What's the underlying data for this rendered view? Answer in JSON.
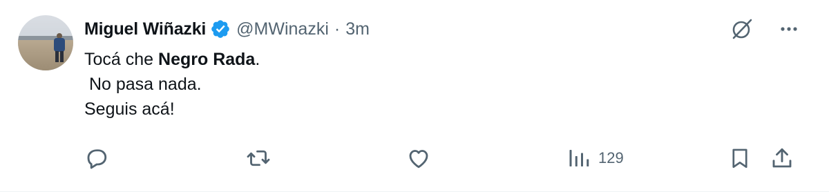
{
  "author": {
    "display_name": "Miguel Wiñazki",
    "handle": "@MWinazki",
    "separator": "·",
    "time": "3m",
    "verified": true
  },
  "post": {
    "lines": [
      {
        "parts": [
          {
            "text": "Tocá che ",
            "bold": false
          },
          {
            "text": "Negro Rada",
            "bold": true
          },
          {
            "text": ".",
            "bold": false
          }
        ]
      },
      {
        "parts": [
          {
            "text": " No pasa nada.",
            "bold": false
          }
        ]
      },
      {
        "parts": [
          {
            "text": "Seguis acá!",
            "bold": false
          }
        ]
      }
    ]
  },
  "actions": {
    "views_count": "129"
  },
  "icons": {
    "avatar": "profile-photo",
    "verified": "verified-badge-icon",
    "grok": "grok-icon",
    "more": "more-icon",
    "reply": "reply-icon",
    "repost": "repost-icon",
    "like": "like-icon",
    "views": "views-icon",
    "bookmark": "bookmark-icon",
    "share": "share-icon"
  },
  "colors": {
    "verified": "#1d9bf0",
    "text": "#0f1419",
    "secondary": "#536471"
  }
}
